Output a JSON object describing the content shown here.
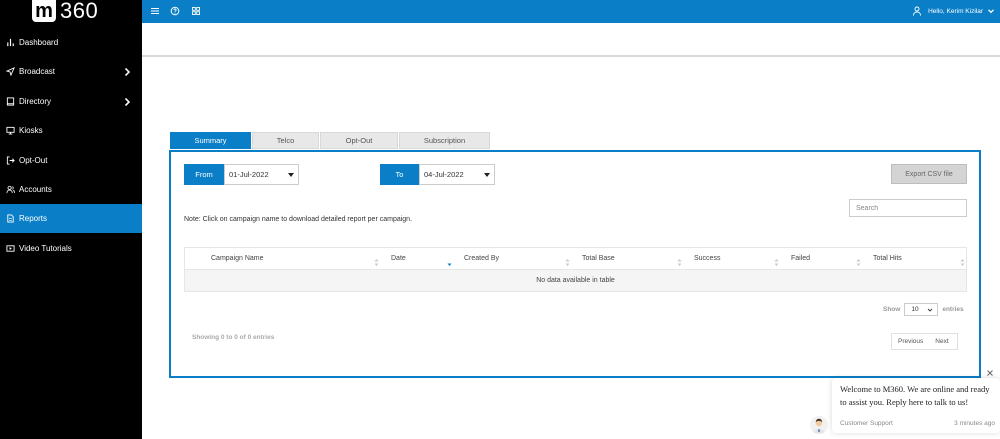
{
  "brand": {
    "logo_m": "m",
    "logo_num": "360"
  },
  "sidebar": {
    "items": [
      {
        "label": "Dashboard",
        "icon": "bar-chart-icon"
      },
      {
        "label": "Broadcast",
        "icon": "send-icon"
      },
      {
        "label": "Directory",
        "icon": "book-icon"
      },
      {
        "label": "Kiosks",
        "icon": "monitor-icon"
      },
      {
        "label": "Opt-Out",
        "icon": "logout-icon"
      },
      {
        "label": "Accounts",
        "icon": "users-icon"
      },
      {
        "label": "Reports",
        "icon": "file-icon"
      },
      {
        "label": "Video Tutorials",
        "icon": "video-icon"
      }
    ],
    "active": "Reports"
  },
  "topbar": {
    "user_label": "Hello, Kerim Kizilar"
  },
  "tabs": [
    "Summary",
    "Telco",
    "Opt-Out",
    "Subscription"
  ],
  "filters": {
    "from_label": "From",
    "from_value": "01-Jul-2022",
    "to_label": "To",
    "to_value": "04-Jul-2022",
    "export_label": "Export CSV file"
  },
  "note": "Note: Click on campaign name to download detailed report per campaign.",
  "search": {
    "placeholder": "Search"
  },
  "table": {
    "columns": [
      "Campaign Name",
      "Date",
      "Created By",
      "Total Base",
      "Success",
      "Failed",
      "Total Hits"
    ],
    "empty_message": "No data available in table"
  },
  "pagination": {
    "show_label": "Show",
    "page_size": "10",
    "entries_label": "entries",
    "info": "Showing 0 to 0 of 0 entries",
    "previous": "Previous",
    "next": "Next"
  },
  "chat": {
    "message": "Welcome to M360. We are online and ready to assist you. Reply here to talk to us!",
    "sender": "Customer Support",
    "time": "3 minutes ago"
  },
  "colors": {
    "accent": "#0a7fc7",
    "sidebar": "#000000"
  }
}
